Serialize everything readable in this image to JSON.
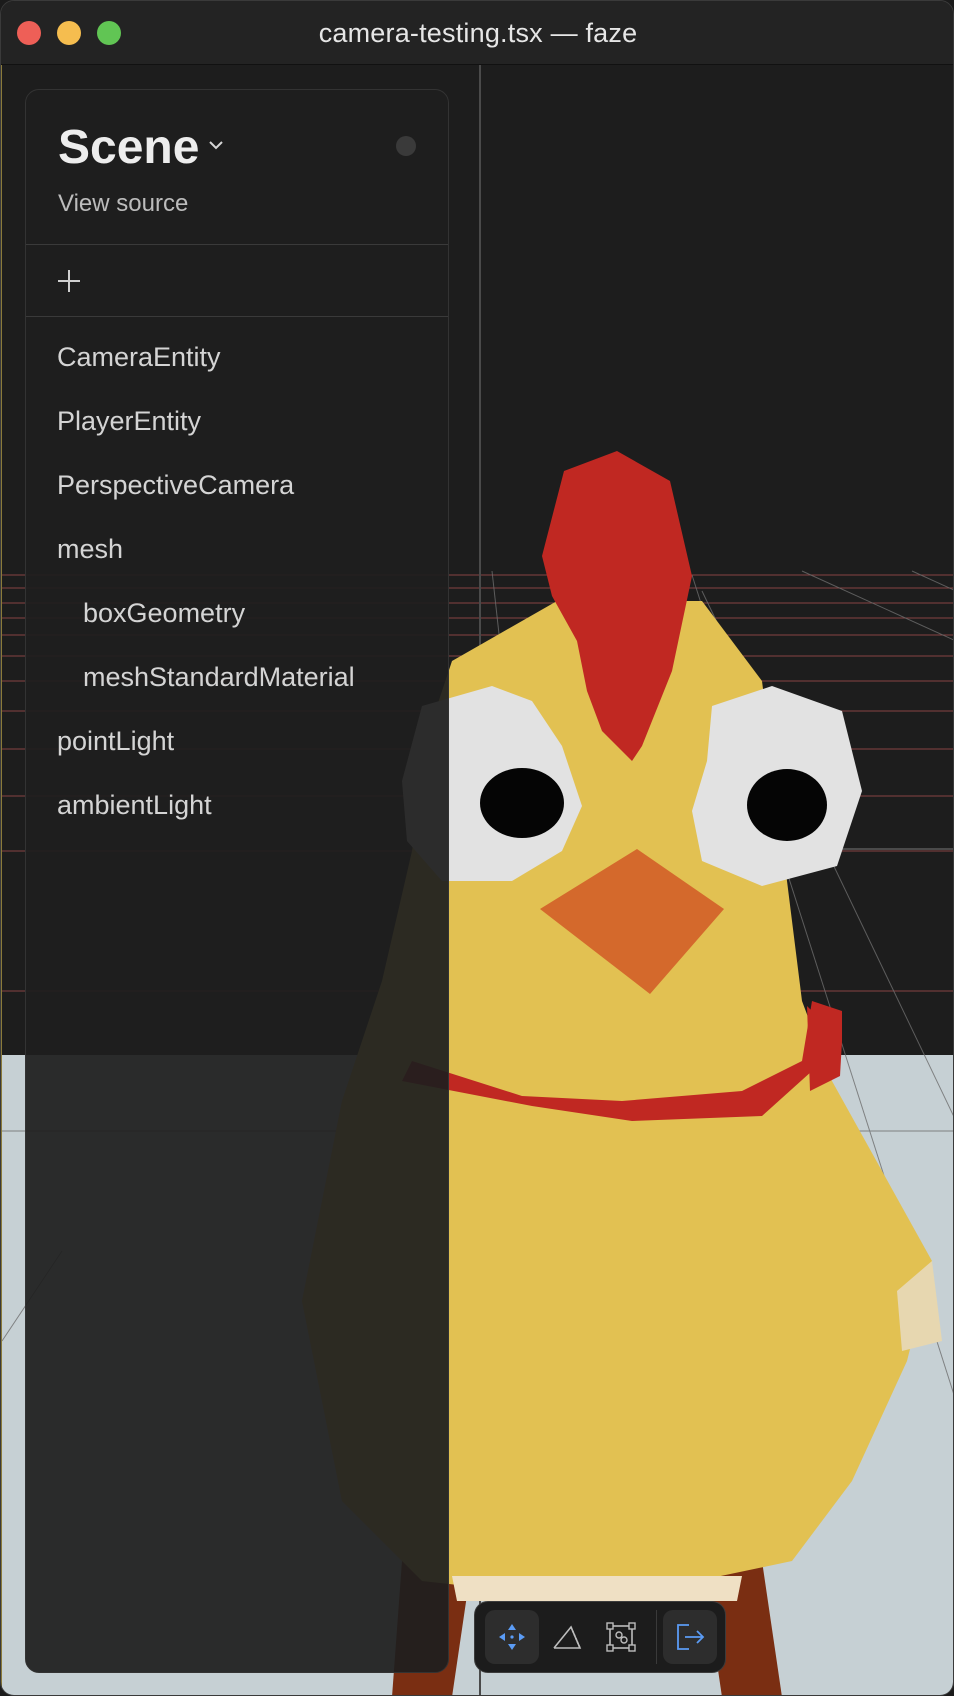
{
  "window": {
    "title": "camera-testing.tsx — faze"
  },
  "panel": {
    "title": "Scene",
    "view_source_label": "View source",
    "add_icon": "plus-icon",
    "items": [
      {
        "label": "CameraEntity",
        "depth": 0
      },
      {
        "label": "PlayerEntity",
        "depth": 0
      },
      {
        "label": "PerspectiveCamera",
        "depth": 0
      },
      {
        "label": "mesh",
        "depth": 0
      },
      {
        "label": "boxGeometry",
        "depth": 1
      },
      {
        "label": "meshStandardMaterial",
        "depth": 1
      },
      {
        "label": "pointLight",
        "depth": 0
      },
      {
        "label": "ambientLight",
        "depth": 0
      }
    ]
  },
  "toolbar": {
    "tools": [
      {
        "name": "move-icon",
        "active": true
      },
      {
        "name": "perspective-icon",
        "active": false
      },
      {
        "name": "bounding-box-icon",
        "active": false
      },
      {
        "name": "exit-icon",
        "active": false
      }
    ]
  },
  "colors": {
    "accent": "#5b9cf5",
    "chick_body": "#e2c152",
    "comb": "#c02822",
    "beak": "#d4692c",
    "floor": "#c6d0d4",
    "grid_red": "#9a4a4a"
  }
}
